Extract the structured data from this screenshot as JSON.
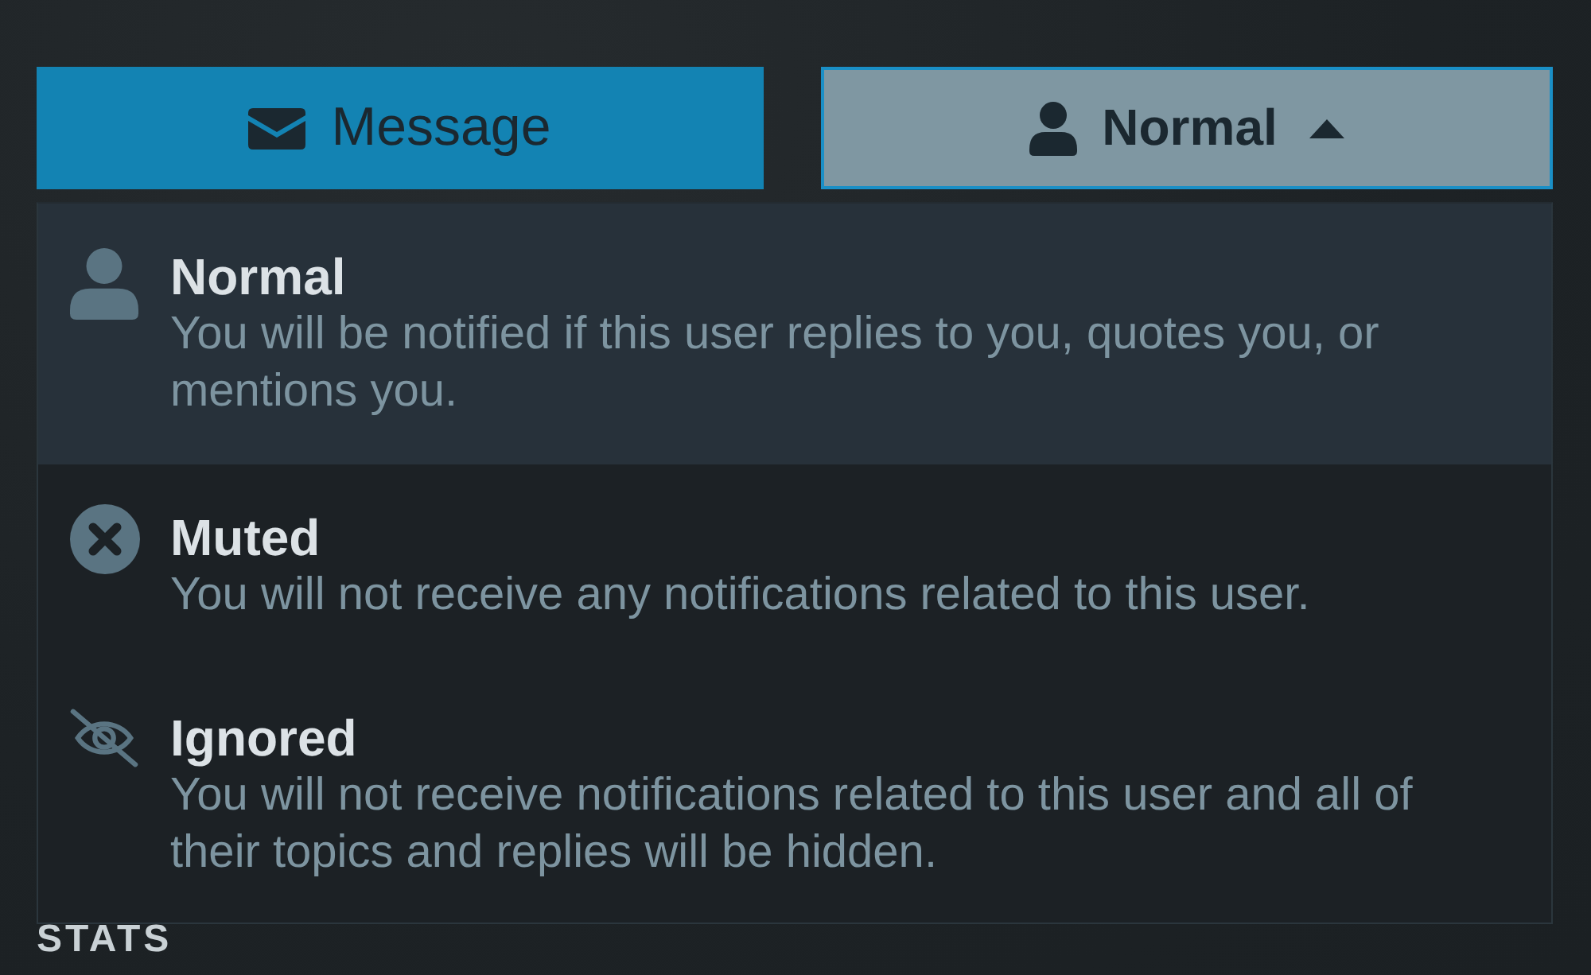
{
  "message_button": {
    "label": "Message"
  },
  "notification_dropdown": {
    "label": "Normal",
    "expanded": true
  },
  "notification_options": [
    {
      "kind": "normal",
      "title": "Normal",
      "description": "You will be notified if this user replies to you, quotes you, or mentions you.",
      "selected": true
    },
    {
      "kind": "muted",
      "title": "Muted",
      "description": "You will not receive any notifications related to this user.",
      "selected": false
    },
    {
      "kind": "ignored",
      "title": "Ignored",
      "description": "You will not receive notifications related to this user and all of their topics and replies will be hidden.",
      "selected": false
    }
  ],
  "section_heading": "STATS"
}
